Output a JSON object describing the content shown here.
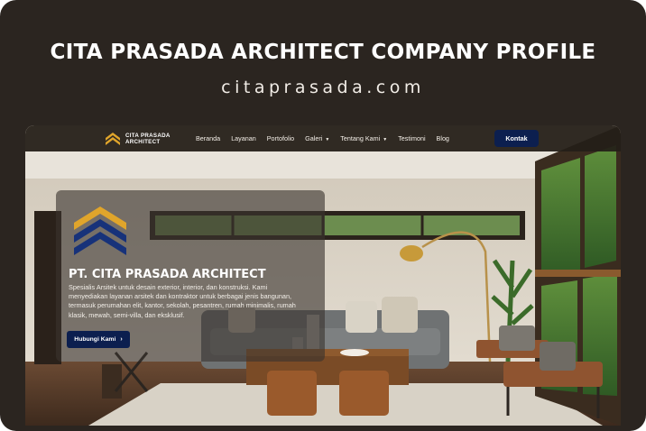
{
  "banner": {
    "headline": "CITA PRASADA ARCHITECT COMPANY PROFILE",
    "domain": "citaprasada.com"
  },
  "site": {
    "brand": {
      "line1": "CITA PRASADA",
      "line2": "ARCHITECT",
      "icon": "chevron-stack-logo-icon"
    },
    "nav": [
      {
        "label": "Beranda",
        "dropdown": false
      },
      {
        "label": "Layanan",
        "dropdown": false
      },
      {
        "label": "Portofolio",
        "dropdown": false
      },
      {
        "label": "Galeri",
        "dropdown": true
      },
      {
        "label": "Tentang Kami",
        "dropdown": true
      },
      {
        "label": "Testimoni",
        "dropdown": false
      },
      {
        "label": "Blog",
        "dropdown": false
      }
    ],
    "contact_label": "Kontak",
    "hero": {
      "title": "PT. CITA PRASADA ARCHITECT",
      "description": "Spesialis Arsitek untuk desain exterior, interior, dan konstruksi. Kami menyediakan layanan arsitek dan kontraktor untuk berbagai jenis bangunan, termasuk perumahan elit, kantor, sekolah, pesantren, rumah minimalis, rumah klasik, mewah, semi-villa, dan eksklusif.",
      "cta_label": "Hubungi Kami",
      "cta_icon": "chevron-right-icon",
      "logo_icon": "chevron-stack-logo-icon"
    }
  },
  "colors": {
    "card_bg": "#2b2520",
    "nav_bg": "#241e18",
    "primary_button": "#0c1f4f",
    "logo_gold": "#e0a52b",
    "logo_blue": "#17327a"
  }
}
